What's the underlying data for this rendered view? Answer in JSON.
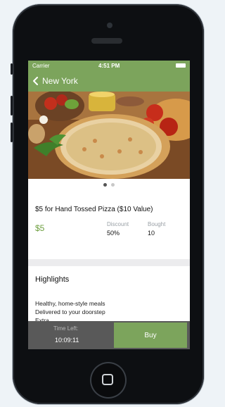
{
  "status_bar": {
    "carrier": "Carrier",
    "time": "4:51 PM"
  },
  "nav": {
    "back_label": "New York",
    "back_icon": "chevron-left-icon"
  },
  "carousel": {
    "pages": 2,
    "active_page": 1
  },
  "deal": {
    "title": "$5 for Hand Tossed Pizza ($10 Value)",
    "price": "$5",
    "discount_label": "Discount",
    "discount_value": "50%",
    "bought_label": "Bought",
    "bought_value": "10"
  },
  "highlights": {
    "title": "Highlights",
    "items": [
      "Healthy, home-style meals",
      "Delivered to your doorstep",
      "Extra..."
    ]
  },
  "footer": {
    "time_left_label": "Time Left:",
    "time_left_value": "10:09:11",
    "buy_label": "Buy"
  },
  "colors": {
    "accent_green": "#7ca45c",
    "price_green": "#6d9f3f",
    "footer_gray": "#595959"
  }
}
